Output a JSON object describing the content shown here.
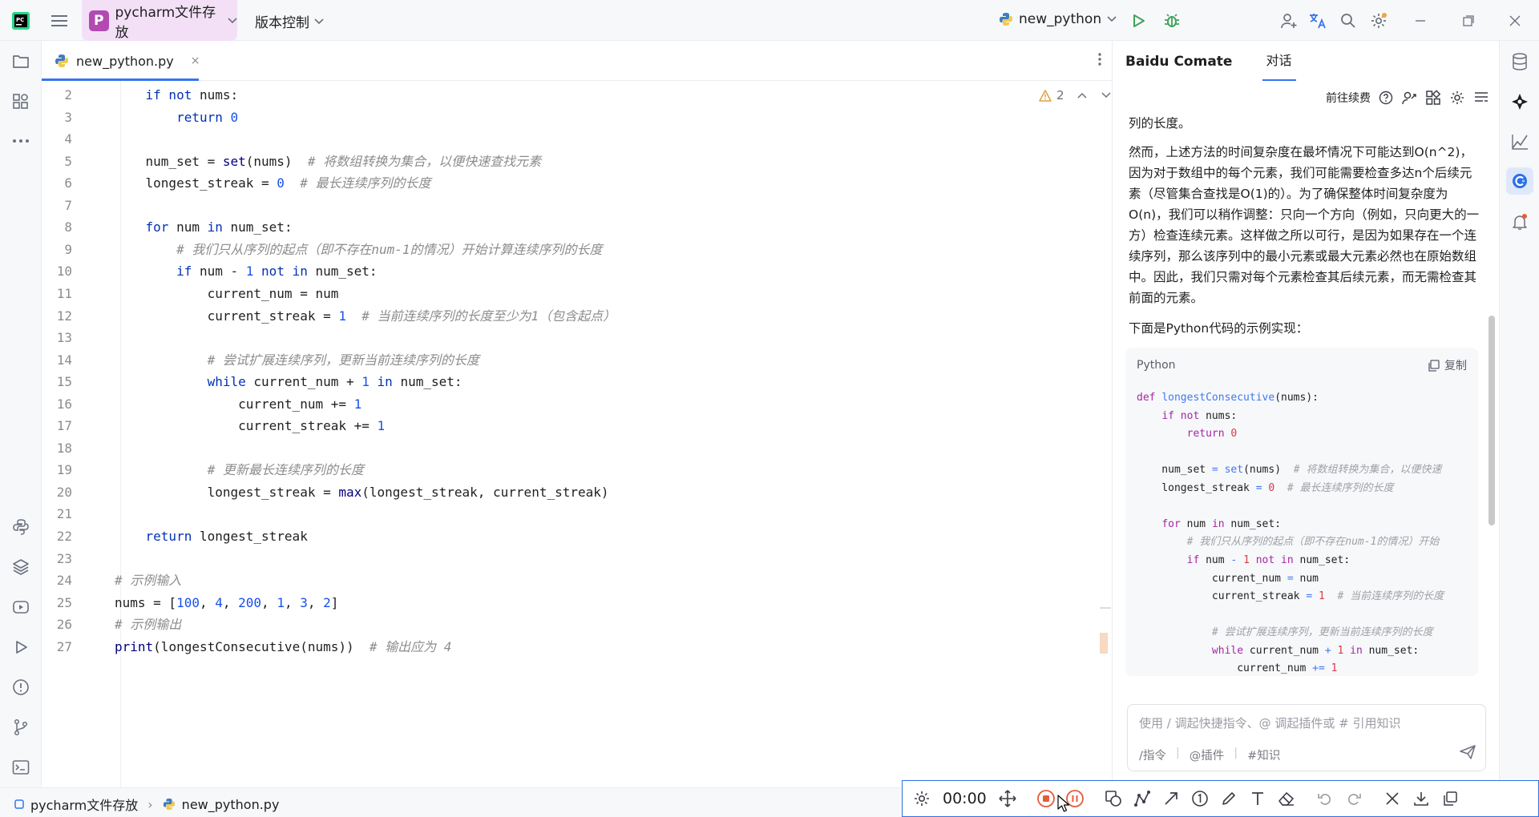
{
  "window": {
    "project_badge": "P",
    "project_name": "pycharm文件存放",
    "vcs_menu": "版本控制",
    "run_config": "new_python"
  },
  "editor": {
    "tab_label": "new_python.py",
    "tab_close": "×",
    "warnings_count": "2",
    "lines": [
      {
        "n": "2",
        "html": "    <span class=\"kw\">if not</span> nums:"
      },
      {
        "n": "3",
        "html": "        <span class=\"kw\">return</span> <span class=\"num\">0</span>"
      },
      {
        "n": "4",
        "html": ""
      },
      {
        "n": "5",
        "html": "    num_set = <span class=\"bi\">set</span>(nums)  <span class=\"cm\"># 将数组转换为集合，以便快速查找元素</span>"
      },
      {
        "n": "6",
        "html": "    longest_streak = <span class=\"num\">0</span>  <span class=\"cm\"># 最长连续序列的长度</span>"
      },
      {
        "n": "7",
        "html": ""
      },
      {
        "n": "8",
        "html": "    <span class=\"kw\">for</span> num <span class=\"kw\">in</span> num_set:"
      },
      {
        "n": "9",
        "html": "        <span class=\"cm\"># 我们只从序列的起点（即不存在num-1的情况）开始计算连续序列的长度</span>"
      },
      {
        "n": "10",
        "html": "        <span class=\"kw\">if</span> num - <span class=\"num\">1</span> <span class=\"kw\">not in</span> num_set:"
      },
      {
        "n": "11",
        "html": "            current_num = num"
      },
      {
        "n": "12",
        "html": "            current_streak = <span class=\"num\">1</span>  <span class=\"cm\"># 当前连续序列的长度至少为1（包含起点）</span>"
      },
      {
        "n": "13",
        "html": ""
      },
      {
        "n": "14",
        "html": "            <span class=\"cm\"># 尝试扩展连续序列，更新当前连续序列的长度</span>"
      },
      {
        "n": "15",
        "html": "            <span class=\"kw\">while</span> current_num + <span class=\"num\">1</span> <span class=\"kw\">in</span> num_set:"
      },
      {
        "n": "16",
        "html": "                current_num += <span class=\"num\">1</span>"
      },
      {
        "n": "17",
        "html": "                current_streak += <span class=\"num\">1</span>"
      },
      {
        "n": "18",
        "html": ""
      },
      {
        "n": "19",
        "html": "            <span class=\"cm\"># 更新最长连续序列的长度</span>"
      },
      {
        "n": "20",
        "html": "            longest_streak = <span class=\"bi\">max</span>(longest_streak, current_streak)"
      },
      {
        "n": "21",
        "html": ""
      },
      {
        "n": "22",
        "html": "    <span class=\"kw\">return</span> longest_streak"
      },
      {
        "n": "23",
        "html": ""
      },
      {
        "n": "24",
        "html": "<span class=\"cm\"># 示例输入</span>"
      },
      {
        "n": "25",
        "html": "nums = [<span class=\"num\">100</span>, <span class=\"num\">4</span>, <span class=\"num\">200</span>, <span class=\"num\">1</span>, <span class=\"num\">3</span>, <span class=\"num\">2</span>]"
      },
      {
        "n": "26",
        "html": "<span class=\"cm\"># 示例输出</span>"
      },
      {
        "n": "27",
        "html": "<span class=\"bi\">print</span>(longestConsecutive(nums))  <span class=\"cm\"># 输出应为 4</span>"
      }
    ]
  },
  "chat": {
    "title": "Baidu Comate",
    "tab": "对话",
    "renew": "前往续费",
    "paragraphs": [
      "列的长度。",
      "然而，上述方法的时间复杂度在最坏情况下可能达到O(n^2)，因为对于数组中的每个元素，我们可能需要检查多达n个后续元素（尽管集合查找是O(1)的）。为了确保整体时间复杂度为O(n)，我们可以稍作调整：只向一个方向（例如，只向更大的一方）检查连续元素。这样做之所以可行，是因为如果存在一个连续序列，那么该序列中的最小元素或最大元素必然也在原始数组中。因此，我们只需对每个元素检查其后续元素，而无需检查其前面的元素。",
      "下面是Python代码的示例实现："
    ],
    "code_lang": "Python",
    "copy_label": "复制",
    "code_lines": [
      "<span class=\"ckw\">def</span> <span class=\"cfn\">longestConsecutive</span>(nums):",
      "    <span class=\"ckw\">if not</span> nums:",
      "        <span class=\"ckw\">return</span> <span class=\"cnum\">0</span>",
      "",
      "    num_set <span class=\"cop\">=</span> <span class=\"cfn\">set</span>(nums)  <span class=\"ccm\"># 将数组转换为集合，以便快速</span>",
      "    longest_streak <span class=\"cop\">=</span> <span class=\"cnum\">0</span>  <span class=\"ccm\"># 最长连续序列的长度</span>",
      "",
      "    <span class=\"ckw\">for</span> num <span class=\"ckw\">in</span> num_set:",
      "        <span class=\"ccm\"># 我们只从序列的起点（即不存在num-1的情况）开始</span>",
      "        <span class=\"ckw\">if</span> num <span class=\"cop\">-</span> <span class=\"cnum\">1</span> <span class=\"ckw\">not in</span> num_set:",
      "            current_num <span class=\"cop\">=</span> num",
      "            current_streak <span class=\"cop\">=</span> <span class=\"cnum\">1</span>  <span class=\"ccm\"># 当前连续序列的长度</span>",
      "",
      "            <span class=\"ccm\"># 尝试扩展连续序列，更新当前连续序列的长度</span>",
      "            <span class=\"ckw\">while</span> current_num <span class=\"cop\">+</span> <span class=\"cnum\">1</span> <span class=\"ckw\">in</span> num_set:",
      "                current_num <span class=\"cop\">+=</span> <span class=\"cnum\">1</span>"
    ],
    "input_placeholder": "使用 / 调起快捷指令、@ 调起插件或 # 引用知识",
    "opt_command": "/指令",
    "opt_plugin": "@插件",
    "opt_knowledge": "#知识",
    "opt_sep": "|"
  },
  "status": {
    "crumb_project": "pycharm文件存放",
    "crumb_file": "new_python.py",
    "crumb_sep": "›"
  },
  "recorder": {
    "time": "00:00"
  },
  "colors": {
    "accent": "#3574f0",
    "project_badge": "#b24ab1",
    "run_green": "#3fa45b",
    "record_red": "#e55b3c"
  }
}
